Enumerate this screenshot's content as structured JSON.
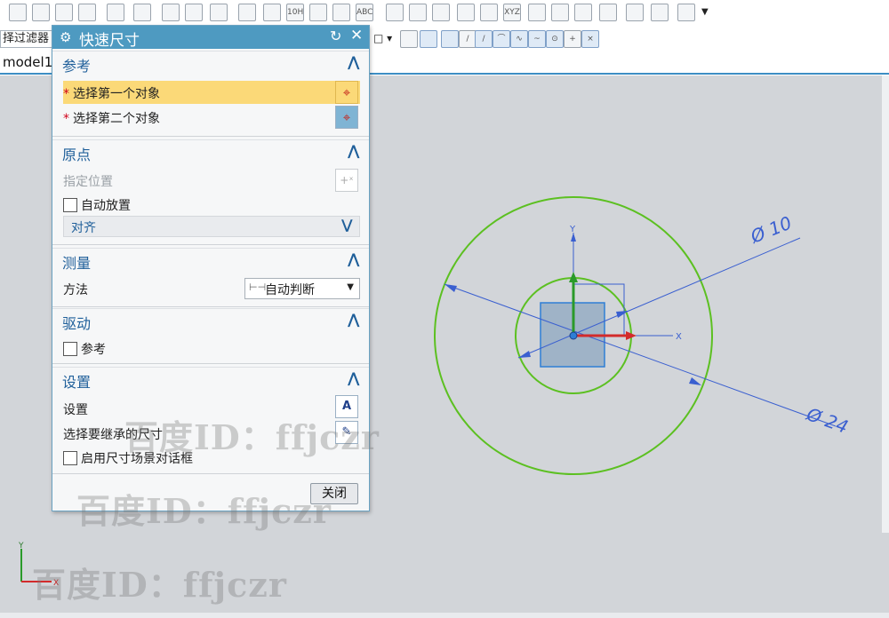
{
  "toolbar": {
    "filter_label": "择过滤器",
    "top_icons": [
      "10H7",
      "ABC",
      "XYZ"
    ]
  },
  "tab": {
    "model": "model1."
  },
  "dialog": {
    "title": "快速尺寸",
    "gear_icon": "⚙",
    "reset_icon": "↻",
    "close_icon": "✕",
    "reference": {
      "label": "参考",
      "first_object": "选择第一个对象",
      "second_object": "选择第二个对象"
    },
    "origin": {
      "label": "原点",
      "specify_location": "指定位置",
      "auto_place": "自动放置",
      "align": "对齐"
    },
    "measure": {
      "label": "测量",
      "method": "方法",
      "method_value": "自动判断"
    },
    "drive": {
      "label": "驱动",
      "reference": "参考"
    },
    "settings": {
      "label": "设置",
      "settings_row": "设置",
      "inherit": "选择要继承的尺寸",
      "enable_dialog": "启用尺寸场景对话框"
    },
    "close_button": "关闭"
  },
  "drawing": {
    "dim_small": "Ø 10",
    "dim_large": "Ø 24",
    "axis_x": "X",
    "axis_y": "Y",
    "triad_x": "X",
    "triad_y": "Y"
  },
  "watermark": "百度ID：ffjczr",
  "colors": {
    "title_bar": "#4e9ac1",
    "highlight": "#fbd978",
    "circle": "#5cc021",
    "dimension": "#3a5fd0",
    "canvas": "#d2d5d9"
  }
}
